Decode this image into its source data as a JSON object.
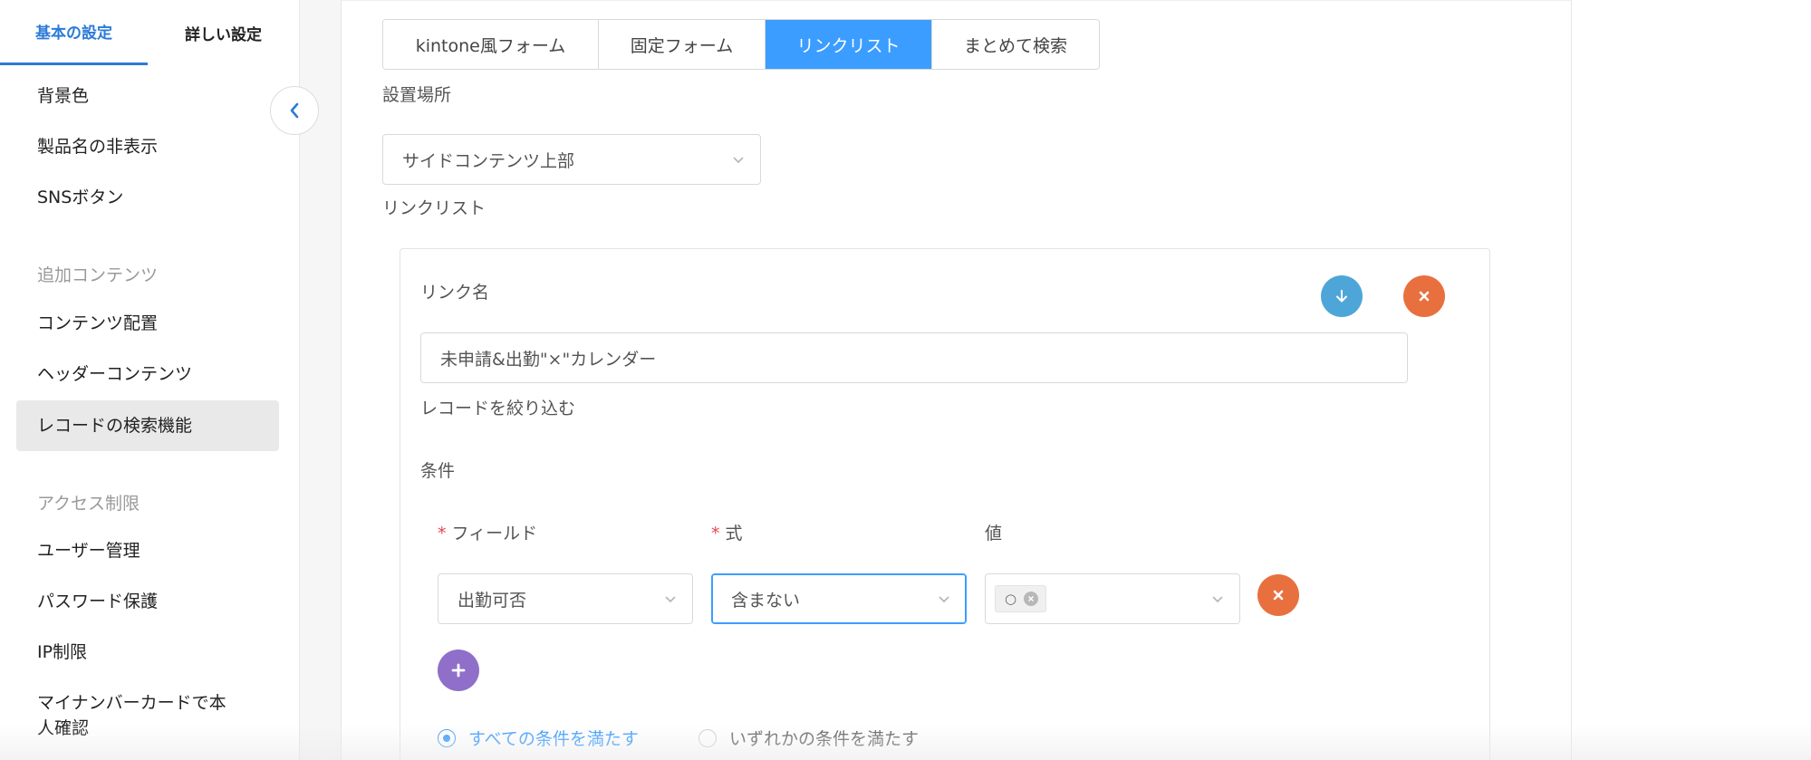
{
  "sidebar": {
    "tabs": [
      {
        "label": "基本の設定",
        "active": true
      },
      {
        "label": "詳しい設定",
        "active": false
      }
    ],
    "items": [
      {
        "label": "背景色"
      },
      {
        "label": "製品名の非表示"
      },
      {
        "label": "SNSボタン"
      },
      {
        "section": "追加コンテンツ"
      },
      {
        "label": "コンテンツ配置"
      },
      {
        "label": "ヘッダーコンテンツ"
      },
      {
        "label": "レコードの検索機能",
        "selected": true
      },
      {
        "section": "アクセス制限"
      },
      {
        "label": "ユーザー管理"
      },
      {
        "label": "パスワード保護"
      },
      {
        "label": "IP制限"
      },
      {
        "label": "マイナンバーカードで本人確認",
        "line1": "マイナンバーカードで本",
        "line2": "人確認"
      }
    ],
    "collapse_icon": "chevron-left-icon"
  },
  "main": {
    "mode_tabs": [
      {
        "label": "kintone風フォーム",
        "active": false
      },
      {
        "label": "固定フォーム",
        "active": false
      },
      {
        "label": "リンクリスト",
        "active": true
      },
      {
        "label": "まとめて検索",
        "active": false
      }
    ],
    "location_label": "設置場所",
    "location_value": "サイドコンテンツ上部",
    "linklist_label": "リンクリスト",
    "card": {
      "link_name_label": "リンク名",
      "link_name_value": "未申請&出勤\"×\"カレンダー",
      "filter_label": "レコードを絞り込む",
      "condition_label": "条件",
      "columns": {
        "field": "フィールド",
        "operator": "式",
        "value": "値",
        "required_mark": "*"
      },
      "row": {
        "field": "出勤可否",
        "operator": "含まない",
        "value_chip": "○"
      },
      "match_options": [
        {
          "label": "すべての条件を満たす",
          "checked": true
        },
        {
          "label": "いずれかの条件を満たす",
          "checked": false
        }
      ]
    },
    "colors": {
      "accent": "#3b9dff",
      "danger": "#e8703f",
      "move": "#4ea6d8",
      "add": "#8f6fc9"
    }
  }
}
